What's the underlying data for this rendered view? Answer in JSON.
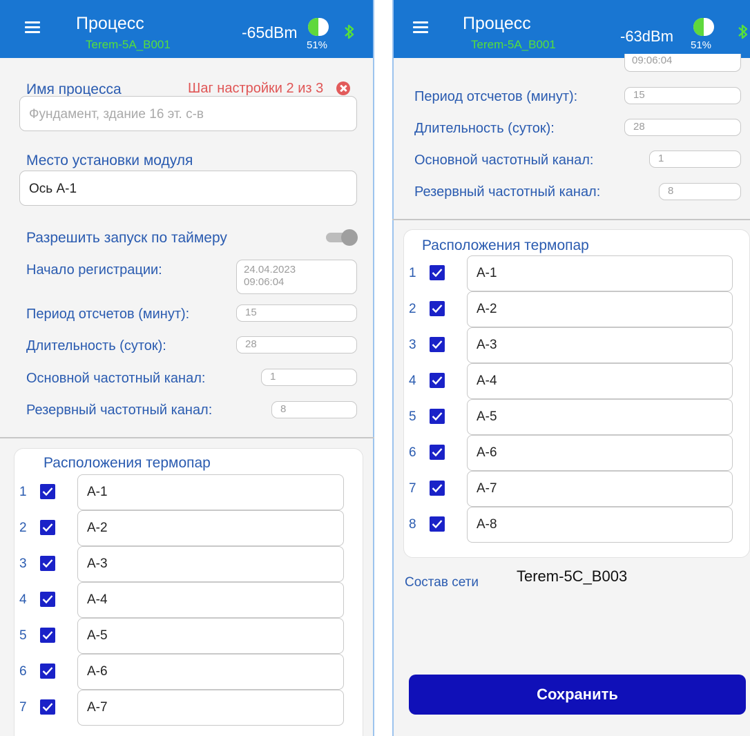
{
  "left": {
    "header": {
      "title": "Процесс",
      "subtitle": "Terem-5A_B001",
      "signal": "-65dBm",
      "battery": "51%",
      "battery_level": 0.51
    },
    "process_name_label": "Имя процесса",
    "step_text": "Шаг настройки 2 из 3",
    "process_name_placeholder": "Фундамент, здание 16 эт. с-в",
    "location_label": "Место установки модуля",
    "location_value": "Ось А-1",
    "timer_label": "Разрешить запуск по таймеру",
    "start_label": "Начало регистрации:",
    "start_date": "24.04.2023",
    "start_time": "09:06:04",
    "period_label": "Период отсчетов (минут):",
    "period_value": "15",
    "duration_label": "Длительность (суток):",
    "duration_value": "28",
    "main_channel_label": "Основной частотный канал:",
    "main_channel_value": "1",
    "reserve_channel_label": "Резервный частотный канал:",
    "reserve_channel_value": "8",
    "thermocouples_title": "Расположения термопар",
    "rows": [
      {
        "num": "1",
        "value": "А-1"
      },
      {
        "num": "2",
        "value": "А-2"
      },
      {
        "num": "3",
        "value": "А-3"
      },
      {
        "num": "4",
        "value": "А-4"
      },
      {
        "num": "5",
        "value": "А-5"
      },
      {
        "num": "6",
        "value": "А-6"
      },
      {
        "num": "7",
        "value": "А-7"
      }
    ]
  },
  "right": {
    "header": {
      "title": "Процесс",
      "subtitle": "Terem-5A_B001",
      "signal": "-63dBm",
      "battery": "51%",
      "battery_level": 0.51
    },
    "start_time": "09:06:04",
    "period_label": "Период отсчетов (минут):",
    "period_value": "15",
    "duration_label": "Длительность (суток):",
    "duration_value": "28",
    "main_channel_label": "Основной частотный канал:",
    "main_channel_value": "1",
    "reserve_channel_label": "Резервный частотный канал:",
    "reserve_channel_value": "8",
    "thermocouples_title": "Расположения термопар",
    "rows": [
      {
        "num": "1",
        "value": "А-1"
      },
      {
        "num": "2",
        "value": "А-2"
      },
      {
        "num": "3",
        "value": "А-3"
      },
      {
        "num": "4",
        "value": "А-4"
      },
      {
        "num": "5",
        "value": "А-5"
      },
      {
        "num": "6",
        "value": "А-6"
      },
      {
        "num": "7",
        "value": "А-7"
      },
      {
        "num": "8",
        "value": "А-8"
      }
    ],
    "network_label": "Состав сети",
    "network_value": "Terem-5C_B003",
    "save_label": "Сохранить"
  },
  "colors": {
    "appbar": "#1976d2",
    "label": "#2a5bb0",
    "step": "#e05555",
    "save": "#1010b8",
    "checkbox": "#1a22c8",
    "subtitle": "#56e03a"
  },
  "icons": {
    "menu": "menu-icon",
    "bluetooth": "bluetooth-icon",
    "battery": "battery-icon",
    "close": "close-icon",
    "check": "check-icon"
  }
}
